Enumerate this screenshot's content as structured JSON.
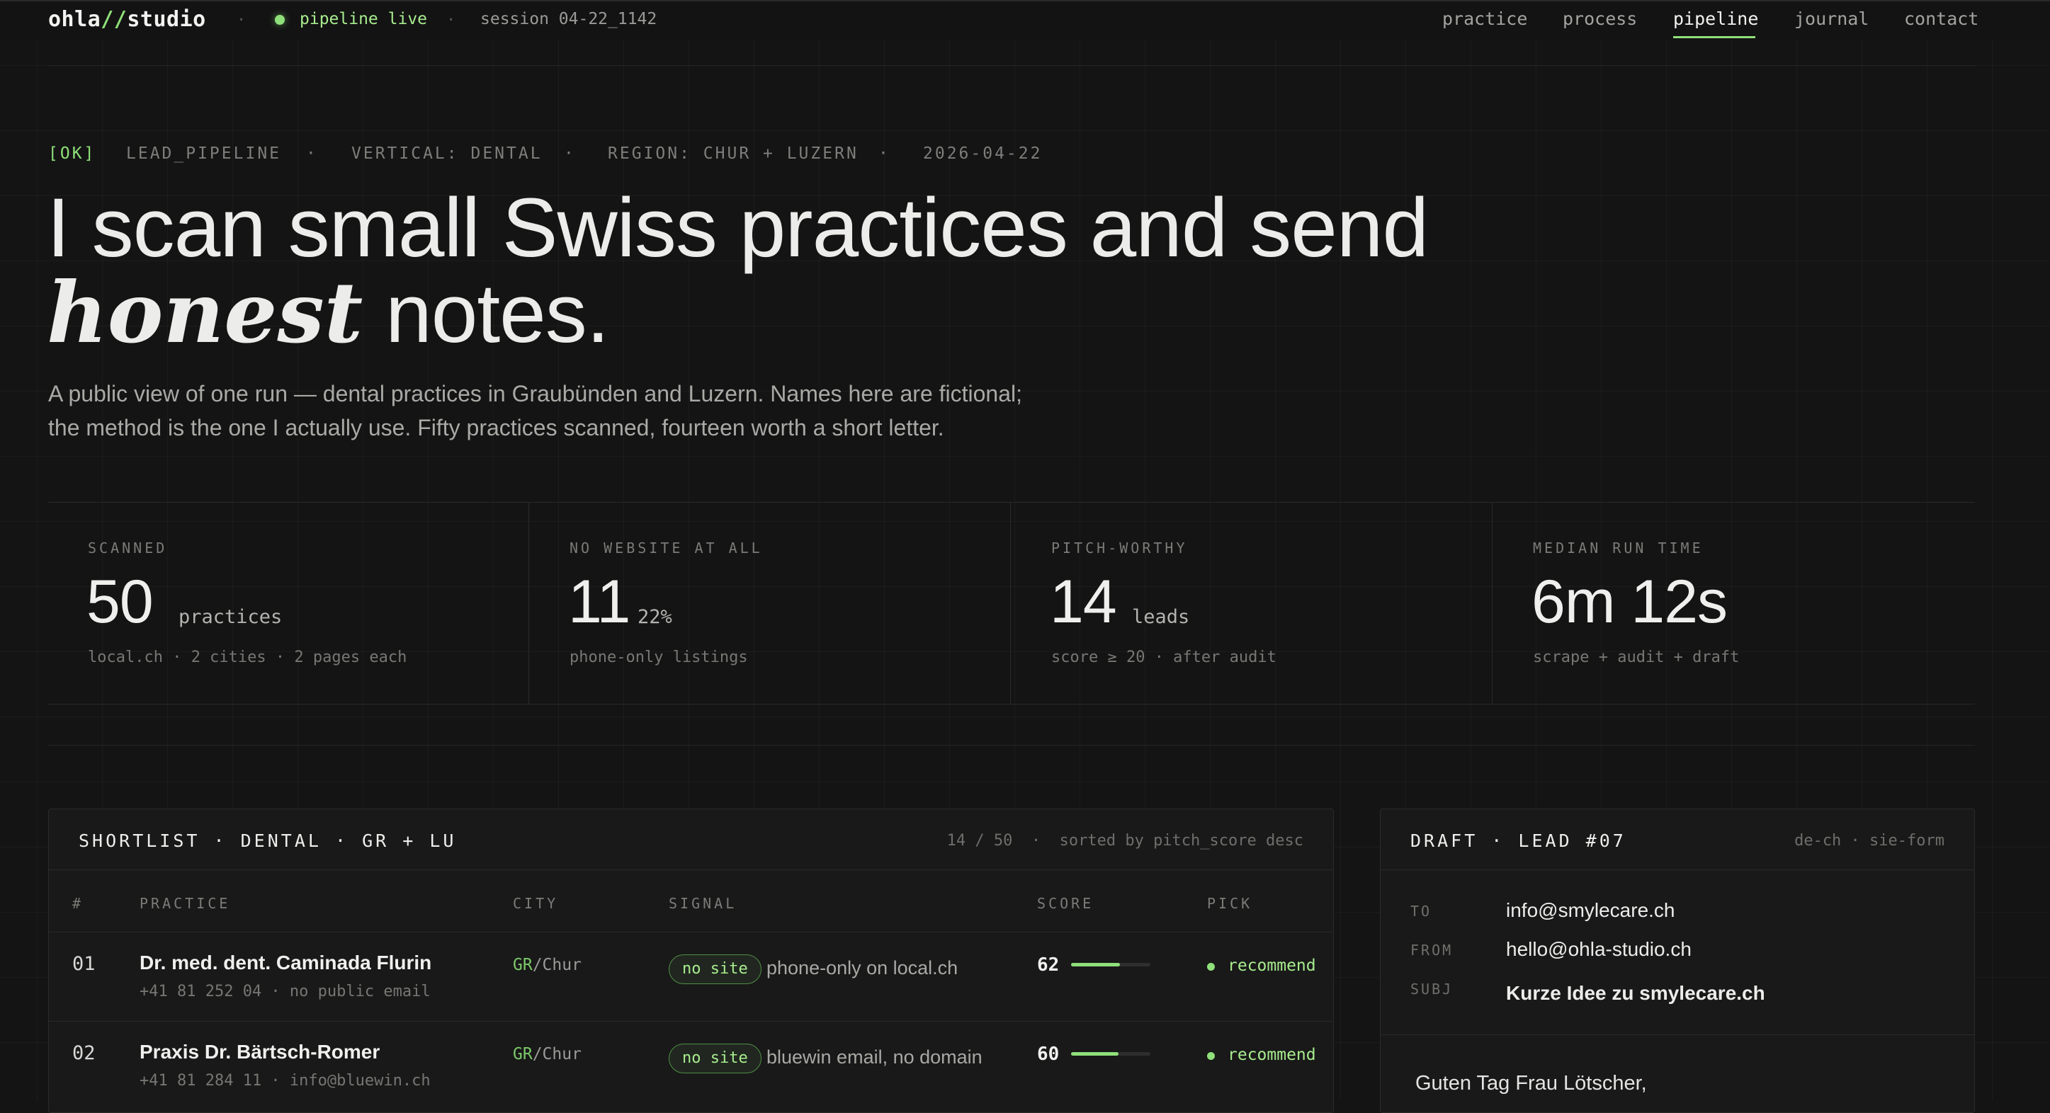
{
  "brand": {
    "name_left": "ohla",
    "slash": "//",
    "name_right": "studio"
  },
  "status": {
    "live_label": "pipeline live",
    "session": "session 04-22_1142",
    "separator": "·"
  },
  "nav": [
    {
      "label": "practice",
      "active": false
    },
    {
      "label": "process",
      "active": false
    },
    {
      "label": "pipeline",
      "active": true
    },
    {
      "label": "journal",
      "active": false
    },
    {
      "label": "contact",
      "active": false
    }
  ],
  "meta": {
    "ok": "[OK]",
    "pipeline": "LEAD_PIPELINE",
    "vertical": "VERTICAL: DENTAL",
    "region": "REGION: CHUR + LUZERN",
    "date": "2026-04-22",
    "separator": "·"
  },
  "hero": {
    "line1": "I scan small Swiss practices and send",
    "emphasis": "honest",
    "line2_rest": " notes.",
    "lede_line1": "A public view of one run — dental practices in Graubünden and Luzern. Names here are fictional;",
    "lede_line2": "the method is the one I actually use. Fifty practices scanned, fourteen worth a short letter."
  },
  "stats": [
    {
      "label": "SCANNED",
      "value": "50",
      "unit": "practices",
      "note": "local.ch · 2 cities · 2 pages each"
    },
    {
      "label": "NO WEBSITE AT ALL",
      "value": "11",
      "unit": "22%",
      "note": "phone-only listings"
    },
    {
      "label": "PITCH-WORTHY",
      "value": "14",
      "unit": "leads",
      "note": "score ≥ 20 · after audit"
    },
    {
      "label": "MEDIAN RUN TIME",
      "value": "6m 12s",
      "unit": "",
      "note": "scrape + audit + draft"
    }
  ],
  "shortlist": {
    "title": "SHORTLIST · DENTAL · GR + LU",
    "meta": "14 / 50  ·  sorted by pitch_score desc",
    "columns": {
      "num": "#",
      "practice": "PRACTICE",
      "city": "CITY",
      "signal": "SIGNAL",
      "score": "SCORE",
      "pick": "PICK"
    },
    "rows": [
      {
        "num": "01",
        "name": "Dr. med. dent. Caminada Flurin",
        "sub": "+41 81 252 04 · no public email",
        "region": "GR",
        "city": "/Chur",
        "badge": "no site",
        "signal": "phone-only on local.ch",
        "score": 62,
        "score_label": "62",
        "pick": "recommend"
      },
      {
        "num": "02",
        "name": "Praxis Dr. Bärtsch-Romer",
        "sub": "+41 81 284 11 · info@bluewin.ch",
        "region": "GR",
        "city": "/Chur",
        "badge": "no site",
        "signal": "bluewin email, no domain",
        "score": 60,
        "score_label": "60",
        "pick": "recommend"
      }
    ]
  },
  "draft": {
    "title": "DRAFT · LEAD #07",
    "meta": "de-ch · sie-form",
    "to_label": "TO",
    "to": "info@smylecare.ch",
    "from_label": "FROM",
    "from": "hello@ohla-studio.ch",
    "subj_label": "SUBJ",
    "subj": "Kurze Idee zu smylecare.ch",
    "greeting": "Guten Tag Frau Lötscher,"
  },
  "colors": {
    "accent": "#8fe07a",
    "background": "#141414",
    "panel": "#191919"
  }
}
